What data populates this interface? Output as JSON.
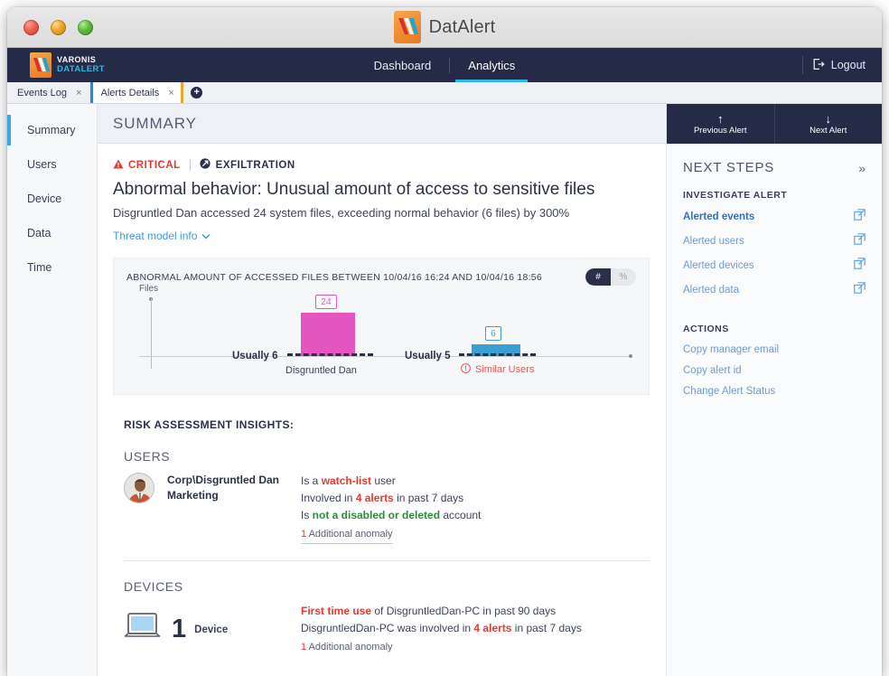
{
  "window": {
    "title": "DatAlert",
    "traffic_lights": [
      "close",
      "minimize",
      "zoom"
    ]
  },
  "navbar": {
    "logo_line1": "VARONIS",
    "logo_line2": "DATALERT",
    "items": [
      {
        "label": "Dashboard",
        "active": false
      },
      {
        "label": "Analytics",
        "active": true
      }
    ],
    "logout_label": "Logout"
  },
  "tabs": {
    "items": [
      {
        "label": "Events  Log",
        "active": false,
        "close": "×"
      },
      {
        "label": "Alerts Details",
        "active": true,
        "close": "×"
      }
    ],
    "add_label": "+"
  },
  "sidebar": {
    "items": [
      {
        "label": "Summary",
        "active": true
      },
      {
        "label": "Users",
        "active": false
      },
      {
        "label": "Device",
        "active": false
      },
      {
        "label": "Data",
        "active": false
      },
      {
        "label": "Time",
        "active": false
      }
    ]
  },
  "main": {
    "header_title": "SUMMARY",
    "severity_badge": "CRITICAL",
    "category_badge": "EXFILTRATION",
    "alert_title": "Abnormal behavior: Unusual amount of access to sensitive files",
    "alert_subtitle": "Disgruntled Dan accessed 24 system files, exceeding normal behavior (6 files) by 300%",
    "threat_model_link": "Threat model info",
    "insights_heading": "RISK ASSESSMENT INSIGHTS:",
    "users_heading": "USERS",
    "devices_heading": "DEVICES",
    "user": {
      "name": "Corp\\Disgruntled Dan",
      "department": "Marketing",
      "facts": [
        {
          "pre": "Is a ",
          "hl": "watch-list",
          "hl_color": "red",
          "post": " user"
        },
        {
          "pre": "Involved in ",
          "hl": "4 alerts",
          "hl_color": "red",
          "post": " in past 7 days"
        },
        {
          "pre": "Is ",
          "hl": "not a disabled or deleted",
          "hl_color": "green",
          "post": " account"
        }
      ],
      "additional_count": "1",
      "additional_label": "Additional anomaly"
    },
    "device": {
      "count": "1",
      "unit": "Device",
      "facts": [
        {
          "pre": "",
          "hl": "First time use",
          "hl_color": "red",
          "post": " of  DisgruntledDan-PC  in past 90 days"
        },
        {
          "pre": "DisgruntledDan-PC  was involved in ",
          "hl": "4 alerts",
          "hl_color": "red",
          "post": " in past 7 days"
        }
      ],
      "additional_count": "1",
      "additional_label": "Additional anomaly"
    }
  },
  "chart_data": {
    "type": "bar",
    "title": "ABNORMAL AMOUNT OF ACCESSED FILES BETWEEN 10/04/16 16:24 AND 10/04/16 18:56",
    "ylabel": "Files",
    "xlabel": "",
    "categories": [
      "Disgruntled Dan",
      "Similar Users"
    ],
    "values": [
      24,
      6
    ],
    "baselines": [
      6,
      5
    ],
    "baseline_labels": [
      "Usually 6",
      "Usually 5"
    ],
    "value_labels": [
      "24",
      "6"
    ],
    "series_colors": [
      "#e356c2",
      "#3c9fd1"
    ],
    "ylim": [
      0,
      30
    ],
    "grid": false,
    "legend": "none",
    "units_toggle": {
      "options": [
        "#",
        "%"
      ],
      "selected": "#"
    },
    "similar_users_warning": true
  },
  "right_panel": {
    "prev_alert": {
      "arrow": "↑",
      "label": "Previous Alert"
    },
    "next_alert": {
      "arrow": "↓",
      "label": "Next Alert"
    },
    "title": "NEXT STEPS",
    "collapse_icon": "»",
    "investigate_heading": "INVESTIGATE ALERT",
    "investigate_links": [
      {
        "label": "Alerted events",
        "bold": true
      },
      {
        "label": "Alerted users",
        "bold": false
      },
      {
        "label": "Alerted devices",
        "bold": false
      },
      {
        "label": "Alerted data",
        "bold": false
      }
    ],
    "actions_heading": "ACTIONS",
    "actions": [
      {
        "label": "Copy manager email"
      },
      {
        "label": "Copy alert id"
      },
      {
        "label": "Change Alert Status"
      }
    ]
  },
  "colors": {
    "navy": "#252a47",
    "accent_blue": "#35b4ea",
    "critical_red": "#e8392f",
    "magenta": "#e356c2",
    "chart_blue": "#3c9fd1",
    "link_blue": "#6e9bd4",
    "brand_orange": "#f08b2e"
  }
}
